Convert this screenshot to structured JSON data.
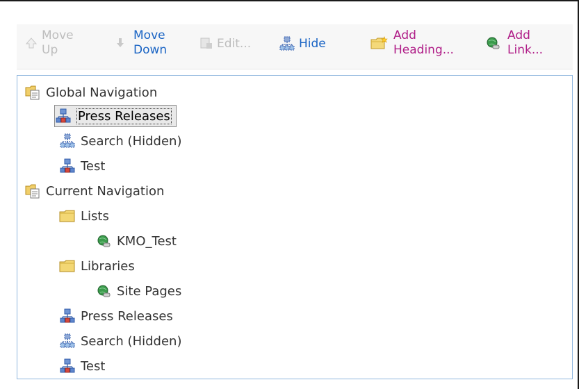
{
  "toolbar": {
    "move_up": "Move\nUp",
    "move_down": "Move\nDown",
    "edit": "Edit...",
    "hide": "Hide",
    "add_heading": "Add\nHeading...",
    "add_link": "Add\nLink..."
  },
  "tree": {
    "global_navigation": "Global Navigation",
    "global_items": [
      "Press Releases",
      "Search (Hidden)",
      "Test"
    ],
    "current_navigation": "Current Navigation",
    "lists_heading": "Lists",
    "lists_link": "KMO_Test",
    "libraries_heading": "Libraries",
    "libraries_link": "Site Pages",
    "current_items": [
      "Press Releases",
      "Search (Hidden)",
      "Test"
    ]
  },
  "colors": {
    "link_blue": "#1a64c4",
    "heading_magenta": "#b01e88",
    "disabled_gray": "#bdbdbd",
    "panel_border": "#8fb6de"
  }
}
